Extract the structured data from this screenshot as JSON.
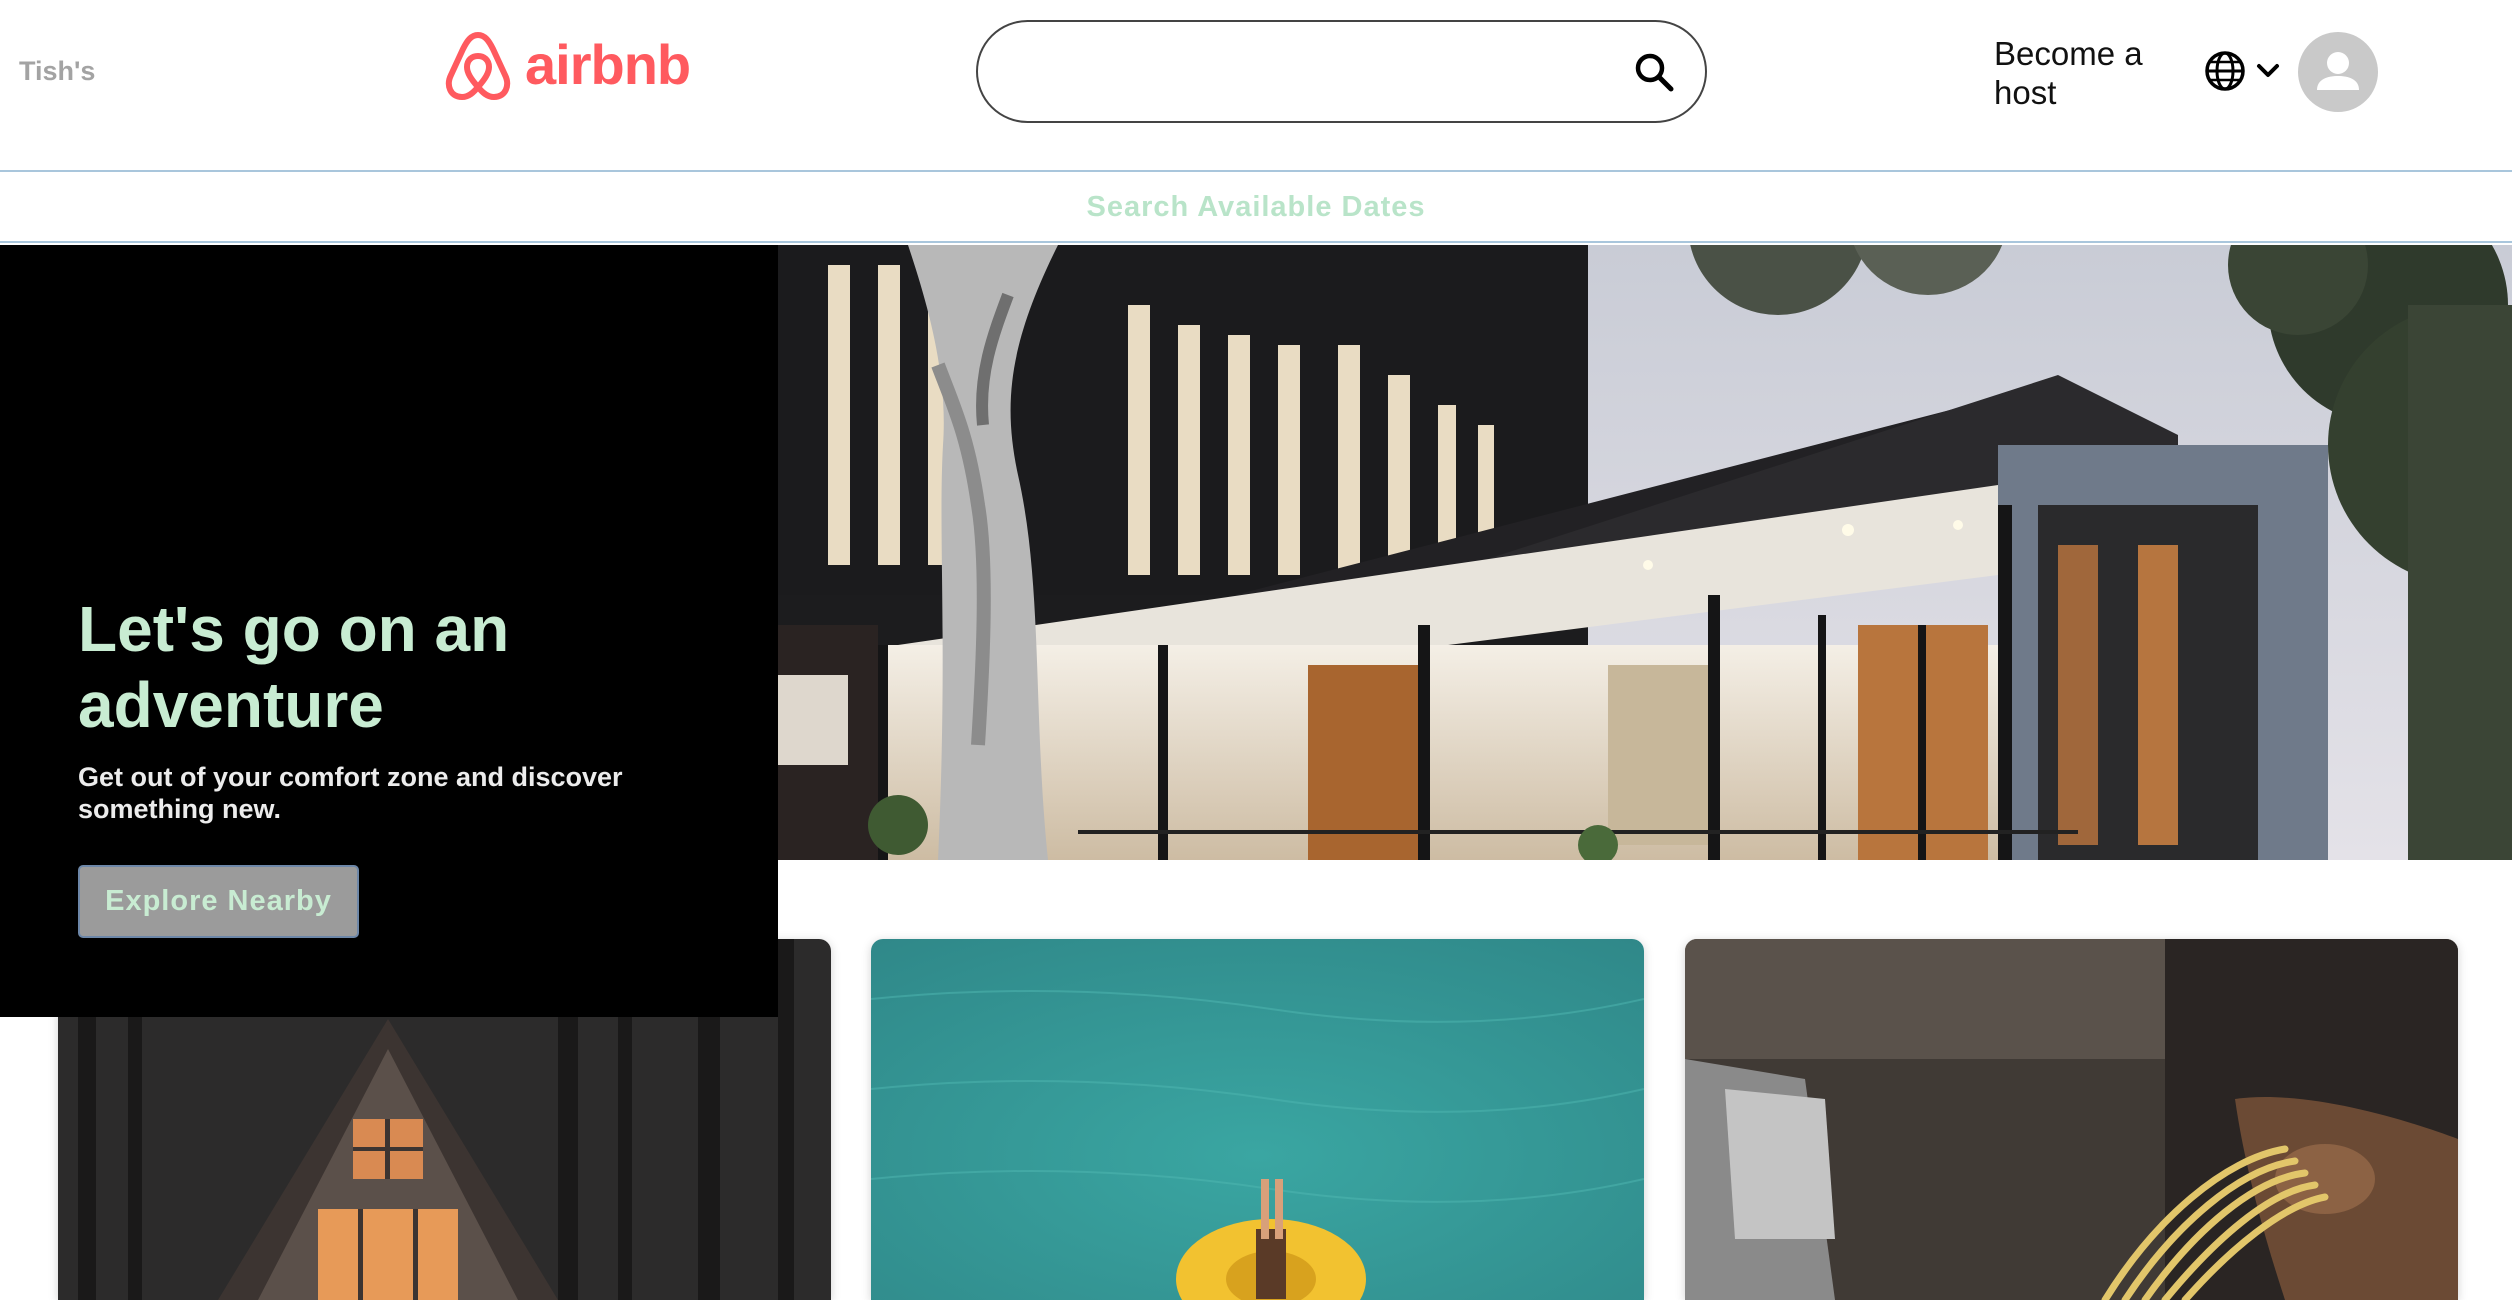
{
  "header": {
    "brand_owner": "Tish's",
    "logo_text": "airbnb",
    "search": {
      "value": "",
      "placeholder": ""
    },
    "host_link": "Become a host",
    "icons": {
      "logo": "airbnb-logo-icon",
      "search": "search-icon",
      "language": "globe-icon",
      "dropdown": "chevron-down-icon",
      "avatar": "user-avatar-icon"
    }
  },
  "dates_bar": {
    "label": "Search Available Dates"
  },
  "hero": {
    "title": "Let's go on an adventure",
    "subtitle": "Get out of your comfort zone and discover something new.",
    "button": "Explore Nearby",
    "image": "modern-house-photo"
  },
  "cards": [
    {
      "image": "a-frame-cabin-photo"
    },
    {
      "image": "pool-float-photo"
    },
    {
      "image": "pasta-making-photo"
    }
  ],
  "colors": {
    "brand": "#ff5a5f",
    "accent_green": "#c8ecd2",
    "dates_text": "#b9e4c9",
    "divider": "#a9c6dc",
    "hero_panel": "#000000"
  }
}
